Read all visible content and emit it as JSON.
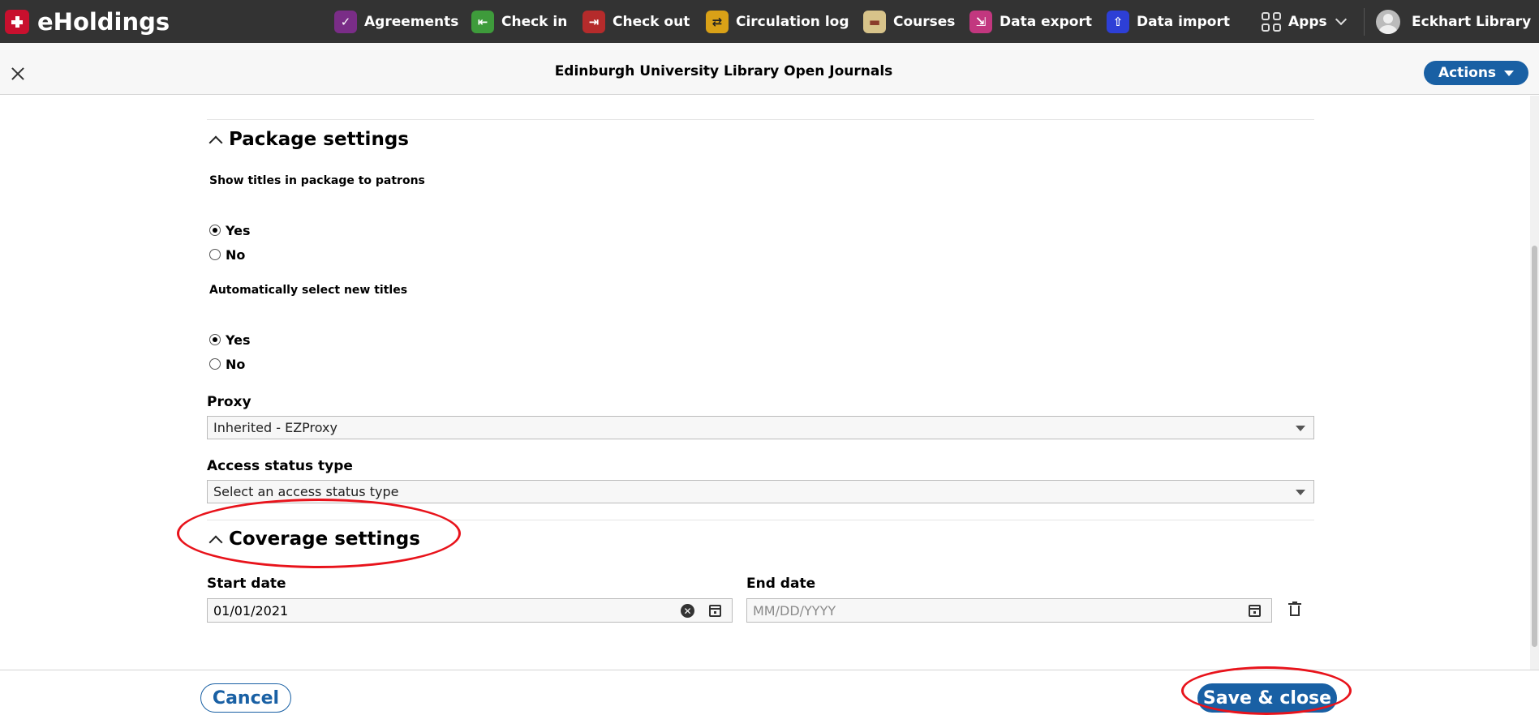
{
  "brand": {
    "name": "eHoldings"
  },
  "nav": {
    "apps": [
      {
        "label": "Agreements",
        "icon": "agreements-icon",
        "color": "#7a2d87"
      },
      {
        "label": "Check in",
        "icon": "check-in-icon",
        "color": "#3e9b3b"
      },
      {
        "label": "Check out",
        "icon": "check-out-icon",
        "color": "#b52b2b"
      },
      {
        "label": "Circulation log",
        "icon": "circulation-log-icon",
        "color": "#d9a117"
      },
      {
        "label": "Courses",
        "icon": "courses-icon",
        "color": "#d7c38a"
      },
      {
        "label": "Data export",
        "icon": "data-export-icon",
        "color": "#c2377f"
      },
      {
        "label": "Data import",
        "icon": "data-import-icon",
        "color": "#2d3fd6"
      }
    ],
    "apps_menu_label": "Apps",
    "user_label": "Eckhart Library"
  },
  "pane": {
    "title": "Edinburgh University Library Open Journals",
    "actions_label": "Actions"
  },
  "package_settings": {
    "title": "Package settings",
    "show_titles": {
      "label": "Show titles in package to patrons",
      "options": [
        {
          "label": "Yes",
          "checked": true
        },
        {
          "label": "No",
          "checked": false
        }
      ]
    },
    "auto_select": {
      "label": "Automatically select new titles",
      "options": [
        {
          "label": "Yes",
          "checked": true
        },
        {
          "label": "No",
          "checked": false
        }
      ]
    },
    "proxy": {
      "label": "Proxy",
      "value": "Inherited - EZProxy"
    },
    "access_status": {
      "label": "Access status type",
      "placeholder": "Select an access status type"
    }
  },
  "coverage_settings": {
    "title": "Coverage settings",
    "start_date": {
      "label": "Start date",
      "value": "01/01/2021"
    },
    "end_date": {
      "label": "End date",
      "placeholder": "MM/DD/YYYY"
    }
  },
  "footer": {
    "cancel_label": "Cancel",
    "save_label": "Save & close"
  },
  "colors": {
    "primary": "#1960a4",
    "nav_bg": "#333333",
    "annotation": "#e8131b"
  }
}
